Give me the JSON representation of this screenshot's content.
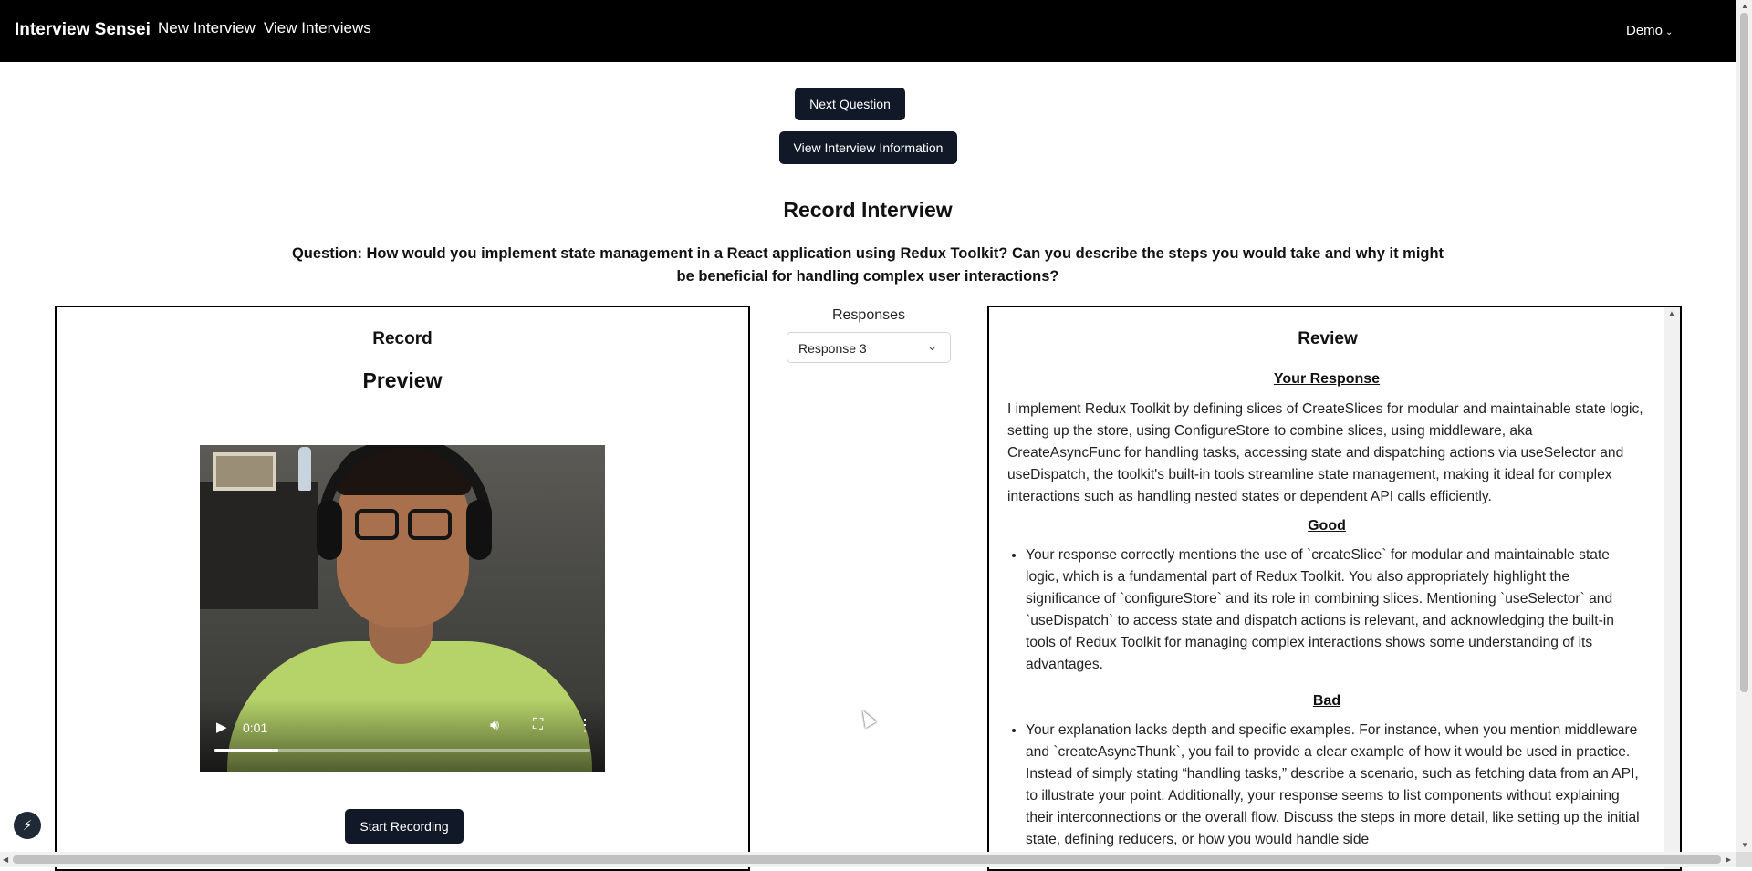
{
  "navbar": {
    "brand": "Interview Sensei",
    "links": [
      "New Interview",
      "View Interviews"
    ],
    "user_menu": "Demo"
  },
  "actions": {
    "next_question": "Next Question",
    "view_info": "View Interview Information"
  },
  "page": {
    "title": "Record Interview",
    "question": "Question: How would you implement state management in a React application using Redux Toolkit? Can you describe the steps you would take and why it might be beneficial for handling complex user interactions?"
  },
  "record": {
    "heading": "Record",
    "preview_heading": "Preview",
    "video": {
      "time": "0:01",
      "progress_fraction": 0.17
    },
    "start_button": "Start Recording"
  },
  "responses": {
    "label": "Responses",
    "selected": "Response 3"
  },
  "review": {
    "heading": "Review",
    "your_response_heading": "Your Response",
    "your_response_text": "I implement Redux Toolkit by defining slices of CreateSlices for modular and maintainable state logic, setting up the store, using ConfigureStore to combine slices, using middleware, aka CreateAsyncFunc for handling tasks, accessing state and dispatching actions via useSelector and useDispatch, the toolkit's built-in tools streamline state management, making it ideal for complex interactions such as handling nested states or dependent API calls efficiently.",
    "good_heading": "Good",
    "good_items": [
      "Your response correctly mentions the use of `createSlice` for modular and maintainable state logic, which is a fundamental part of Redux Toolkit. You also appropriately highlight the significance of `configureStore` and its role in combining slices. Mentioning `useSelector` and `useDispatch` to access state and dispatch actions is relevant, and acknowledging the built-in tools of Redux Toolkit for managing complex interactions shows some understanding of its advantages."
    ],
    "bad_heading": "Bad",
    "bad_items": [
      "Your explanation lacks depth and specific examples. For instance, when you mention middleware and `createAsyncThunk`, you fail to provide a clear example of how it would be used in practice. Instead of simply stating “handling tasks,” describe a scenario, such as fetching data from an API, to illustrate your point. Additionally, your response seems to list components without explaining their interconnections or the overall flow. Discuss the steps in more detail, like setting up the initial state, defining reducers, or how you would handle side"
    ]
  },
  "icons": {
    "play": "play-icon",
    "volume": "volume-icon",
    "fullscreen": "fullscreen-icon",
    "more": "more-vertical-icon",
    "chevron": "chevron-down-icon",
    "bolt": "lightning-bolt-icon"
  },
  "colors": {
    "navbar_bg": "#000000",
    "button_bg": "#111827",
    "panel_border": "#000000"
  }
}
